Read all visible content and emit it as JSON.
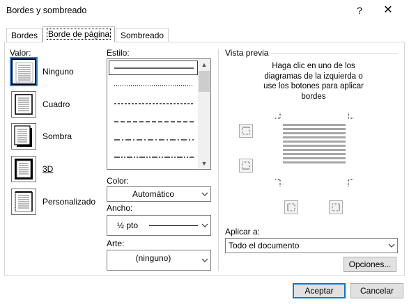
{
  "window": {
    "title": "Bordes y sombreado",
    "help_glyph": "?",
    "close_glyph": "✕"
  },
  "tabs": [
    {
      "label": "Bordes",
      "active": false
    },
    {
      "label": "Borde de página",
      "active": true
    },
    {
      "label": "Sombreado",
      "active": false
    }
  ],
  "settings": {
    "label": "Valor:",
    "items": [
      {
        "label": "Ninguno",
        "icon": "setting-none-icon",
        "selected": true
      },
      {
        "label": "Cuadro",
        "icon": "setting-box-icon",
        "selected": false
      },
      {
        "label": "Sombra",
        "icon": "setting-shadow-icon",
        "selected": false
      },
      {
        "label": "3D",
        "icon": "setting-3d-icon",
        "selected": false
      },
      {
        "label": "Personalizado",
        "icon": "setting-custom-icon",
        "selected": false
      }
    ]
  },
  "style": {
    "label": "Estilo:",
    "options": [
      "solid",
      "dotted",
      "dashed-small",
      "dashed",
      "dash-dot",
      "dash-dot-dot"
    ],
    "selected_index": 0
  },
  "color": {
    "label": "Color:",
    "value": "Automático"
  },
  "width": {
    "label": "Ancho:",
    "value": "½ pto"
  },
  "art": {
    "label": "Arte:",
    "value": "(ninguno)"
  },
  "preview": {
    "label": "Vista previa",
    "hint_lines": [
      "Haga clic en uno de los",
      "diagramas de la izquierda o",
      "use los botones para aplicar",
      "bordes"
    ]
  },
  "apply_to": {
    "label": "Aplicar a:",
    "value": "Todo el documento"
  },
  "buttons": {
    "options": "Opciones...",
    "ok": "Aceptar",
    "cancel": "Cancelar"
  },
  "colors": {
    "accent": "#0078d7",
    "selection_border": "#000000",
    "button_bg": "#e1e1e1"
  }
}
